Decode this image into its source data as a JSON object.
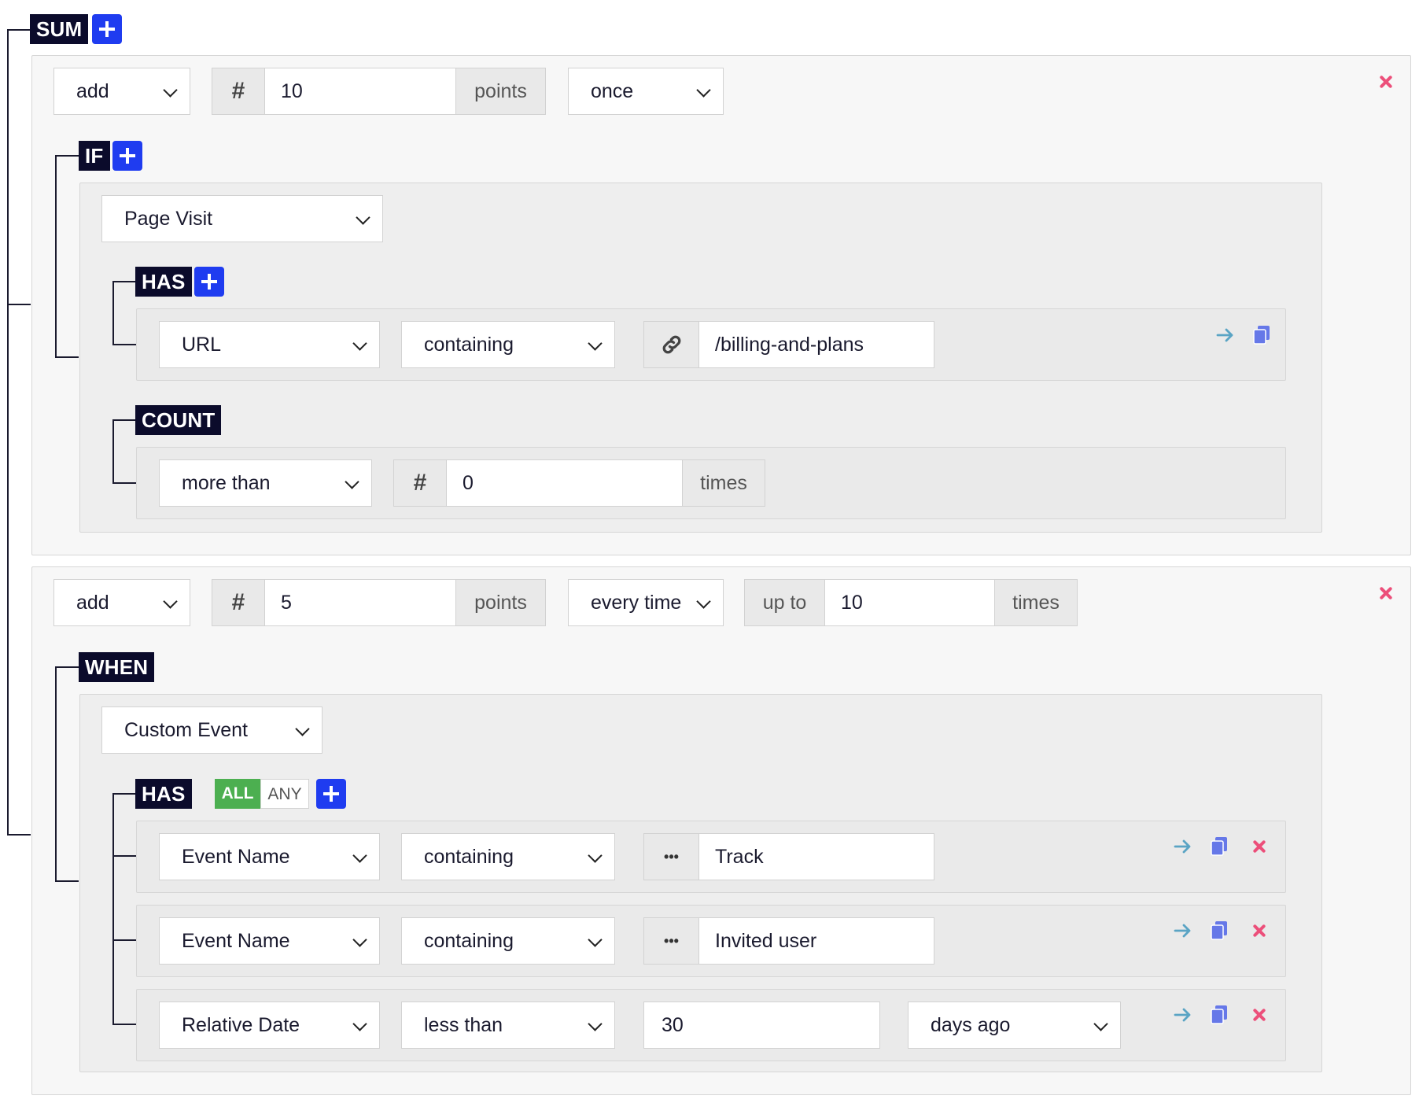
{
  "sum_label": "SUM",
  "rule1": {
    "action": "add",
    "hash": "#",
    "points_value": "10",
    "points_suffix": "points",
    "frequency": "once",
    "if_label": "IF",
    "event_type": "Page Visit",
    "has_label": "HAS",
    "condition": {
      "field": "URL",
      "operator": "containing",
      "value": "/billing-and-plans"
    },
    "count_label": "COUNT",
    "count": {
      "operator": "more than",
      "hash": "#",
      "value": "0",
      "suffix": "times"
    }
  },
  "rule2": {
    "action": "add",
    "hash": "#",
    "points_value": "5",
    "points_suffix": "points",
    "frequency": "every time",
    "upto_label": "up to",
    "upto_value": "10",
    "upto_suffix": "times",
    "when_label": "WHEN",
    "event_type": "Custom Event",
    "has_label": "HAS",
    "match_all": "ALL",
    "match_any": "ANY",
    "ellipsis": "•••",
    "conditions": [
      {
        "field": "Event Name",
        "operator": "containing",
        "value": "Track"
      },
      {
        "field": "Event Name",
        "operator": "containing",
        "value": "Invited user"
      },
      {
        "field": "Relative Date",
        "operator": "less than",
        "value": "30",
        "unit": "days ago"
      }
    ]
  },
  "colors": {
    "tag_bg": "#0b0b2b",
    "plus_btn": "#1f3cf0",
    "delete": "#ec4f7a",
    "arrow": "#5aa4c4",
    "copy": "#6678e8",
    "all_active": "#4caf50"
  },
  "icons": [
    "plus-icon",
    "chevron-down-icon",
    "link-icon",
    "arrow-right-icon",
    "copy-icon",
    "close-icon"
  ]
}
